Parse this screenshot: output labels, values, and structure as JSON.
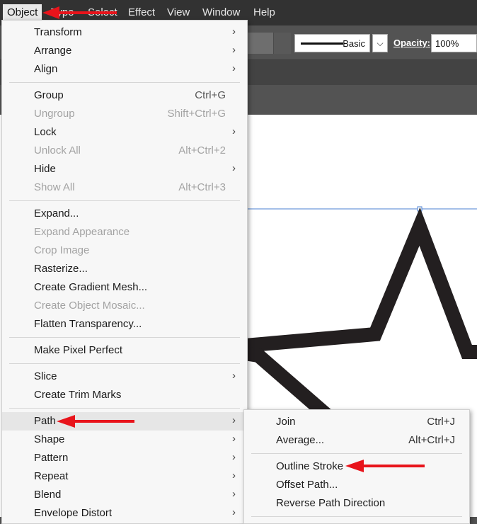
{
  "menubar": {
    "items": [
      "Object",
      "Type",
      "Select",
      "Effect",
      "View",
      "Window",
      "Help"
    ]
  },
  "controlbar": {
    "stroke_label": "Basic",
    "opacity_label": "Opacity:",
    "opacity_value": "100%"
  },
  "object_menu": {
    "transform": "Transform",
    "arrange": "Arrange",
    "align": "Align",
    "group": "Group",
    "group_sc": "Ctrl+G",
    "ungroup": "Ungroup",
    "ungroup_sc": "Shift+Ctrl+G",
    "lock": "Lock",
    "unlock_all": "Unlock All",
    "unlock_all_sc": "Alt+Ctrl+2",
    "hide": "Hide",
    "show_all": "Show All",
    "show_all_sc": "Alt+Ctrl+3",
    "expand": "Expand...",
    "expand_appearance": "Expand Appearance",
    "crop_image": "Crop Image",
    "rasterize": "Rasterize...",
    "gradient_mesh": "Create Gradient Mesh...",
    "object_mosaic": "Create Object Mosaic...",
    "flatten": "Flatten Transparency...",
    "pixel_perfect": "Make Pixel Perfect",
    "slice": "Slice",
    "trim_marks": "Create Trim Marks",
    "path": "Path",
    "shape": "Shape",
    "pattern": "Pattern",
    "repeat": "Repeat",
    "blend": "Blend",
    "envelope": "Envelope Distort"
  },
  "path_menu": {
    "join": "Join",
    "join_sc": "Ctrl+J",
    "average": "Average...",
    "average_sc": "Alt+Ctrl+J",
    "outline_stroke": "Outline Stroke",
    "offset_path": "Offset Path...",
    "reverse_direction": "Reverse Path Direction"
  },
  "icons": {
    "submenu": "chevron-right-icon",
    "dropdown": "chevron-down-icon"
  },
  "colors": {
    "annotation": "#e8141b",
    "menubar": "#323232"
  }
}
